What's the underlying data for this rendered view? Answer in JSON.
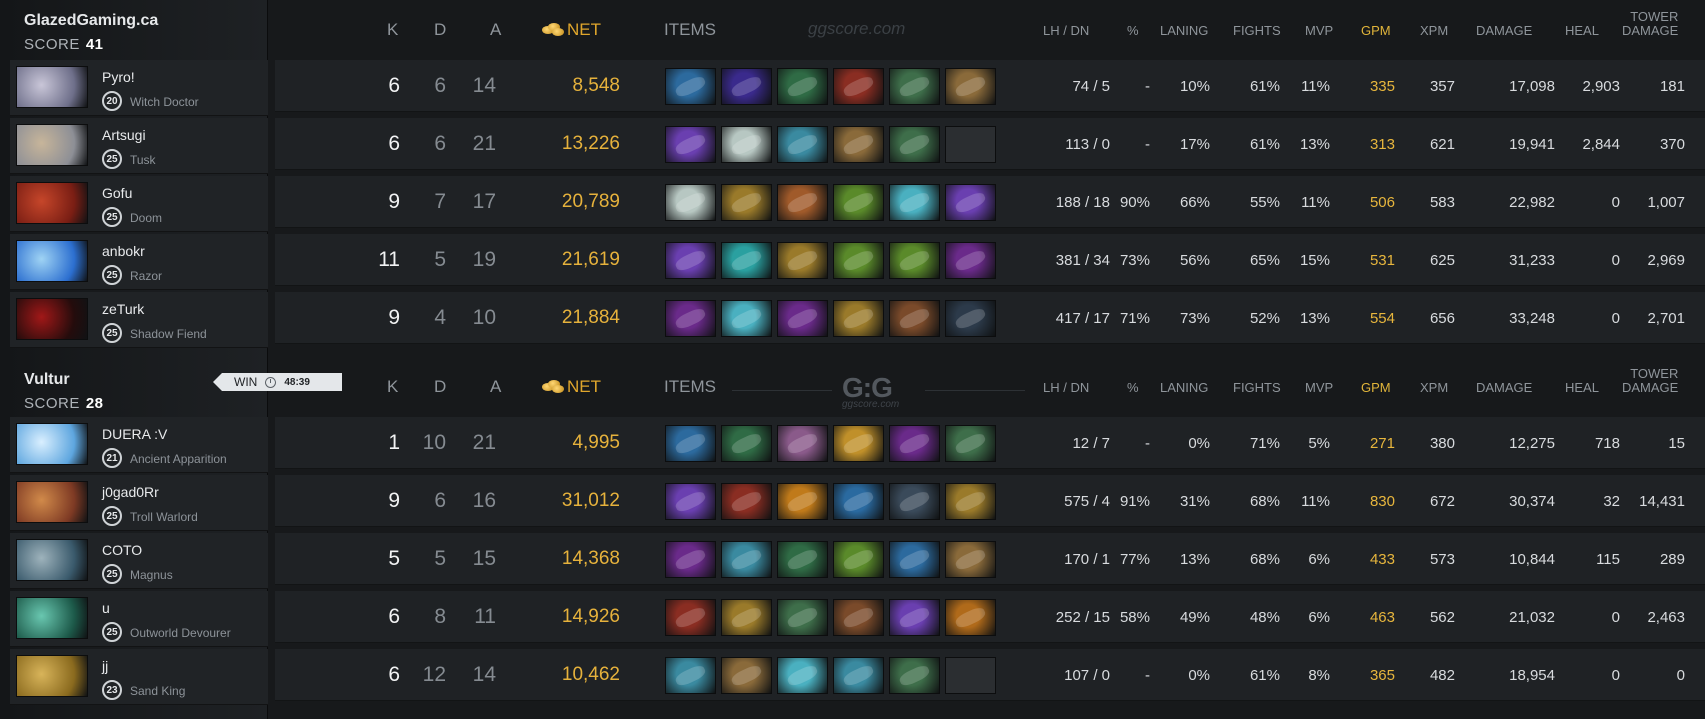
{
  "colors": {
    "item_palette": [
      "#2c6a9e",
      "#3a2a8c",
      "#2f6b45",
      "#8a2d22",
      "#3e6e4a",
      "#8a6a3a",
      "#6a3fb0",
      "#b7c7c2",
      "#3a8aa0",
      "#9a7a2a",
      "#a05a2a",
      "#5a8a2a",
      "#4ab0c0",
      "#2c3a4a",
      "#6a2a8a",
      "#b06a1a",
      "#2aa0a0",
      "#7a4a2a",
      "#c0902a",
      "#2a6aa0",
      "#3a4a5a",
      "#8a5a8a",
      "#c07a1a"
    ],
    "portrait": {
      "witch-doctor": [
        "#6e6f8a",
        "#c9c6d8"
      ],
      "tusk": [
        "#8d8f96",
        "#c7b59a"
      ],
      "doom": [
        "#7a1e14",
        "#c6462a"
      ],
      "razor": [
        "#2c6fd0",
        "#9fd3f4"
      ],
      "shadow-fiend": [
        "#240c0c",
        "#a11818"
      ],
      "ancient-apparition": [
        "#5ea6df",
        "#d9efff"
      ],
      "troll-warlord": [
        "#7e3a24",
        "#d18a4a"
      ],
      "magnus": [
        "#3a5a6c",
        "#9eb3bc"
      ],
      "outworld-devourer": [
        "#1d5a4a",
        "#69c7b0"
      ],
      "sand-king": [
        "#8a6a1e",
        "#d8b45a"
      ]
    }
  },
  "teams": [
    {
      "name": "GlazedGaming.ca",
      "score_label": "SCORE",
      "score": "41",
      "header": {
        "k": "K",
        "d": "D",
        "a": "A",
        "net": "NET",
        "items": "ITEMS",
        "lh_dn": "LH / DN",
        "pct": "%",
        "laning": "LANING",
        "fights": "FIGHTS",
        "mvp": "MVP",
        "gpm": "GPM",
        "xpm": "XPM",
        "damage": "DAMAGE",
        "heal": "HEAL",
        "tower_damage_l1": "TOWER",
        "tower_damage_l2": "DAMAGE"
      },
      "watermark": "ggscore.com",
      "players": [
        {
          "name": "Pyro!",
          "level": "20",
          "hero": "Witch Doctor",
          "portrait": "witch-doctor",
          "k": "6",
          "d": "6",
          "a": "14",
          "net": "8,548",
          "items": [
            0,
            1,
            2,
            3,
            4,
            5
          ],
          "lh_dn": "74  /  5",
          "pct": "-",
          "laning": "10%",
          "fights": "61%",
          "mvp": "11%",
          "gpm": "335",
          "xpm": "357",
          "damage": "17,098",
          "heal": "2,903",
          "tower": "181"
        },
        {
          "name": "Artsugi",
          "level": "25",
          "hero": "Tusk",
          "portrait": "tusk",
          "k": "6",
          "d": "6",
          "a": "21",
          "net": "13,226",
          "items": [
            6,
            7,
            8,
            5,
            4,
            -1
          ],
          "lh_dn": "113  /  0",
          "pct": "-",
          "laning": "17%",
          "fights": "61%",
          "mvp": "13%",
          "gpm": "313",
          "xpm": "621",
          "damage": "19,941",
          "heal": "2,844",
          "tower": "370"
        },
        {
          "name": "Gofu",
          "level": "25",
          "hero": "Doom",
          "portrait": "doom",
          "k": "9",
          "d": "7",
          "a": "17",
          "net": "20,789",
          "items": [
            7,
            9,
            10,
            11,
            12,
            6
          ],
          "lh_dn": "188  /  18",
          "pct": "90%",
          "laning": "66%",
          "fights": "55%",
          "mvp": "11%",
          "gpm": "506",
          "xpm": "583",
          "damage": "22,982",
          "heal": "0",
          "tower": "1,007"
        },
        {
          "name": "anbokr",
          "level": "25",
          "hero": "Razor",
          "portrait": "razor",
          "k": "11",
          "d": "5",
          "a": "19",
          "net": "21,619",
          "items": [
            6,
            16,
            9,
            11,
            11,
            14
          ],
          "lh_dn": "381  /  34",
          "pct": "73%",
          "laning": "56%",
          "fights": "65%",
          "mvp": "15%",
          "gpm": "531",
          "xpm": "625",
          "damage": "31,233",
          "heal": "0",
          "tower": "2,969"
        },
        {
          "name": "zeTurk",
          "level": "25",
          "hero": "Shadow Fiend",
          "portrait": "shadow-fiend",
          "k": "9",
          "d": "4",
          "a": "10",
          "net": "21,884",
          "items": [
            14,
            12,
            14,
            9,
            17,
            13
          ],
          "lh_dn": "417  /  17",
          "pct": "71%",
          "laning": "73%",
          "fights": "52%",
          "mvp": "13%",
          "gpm": "554",
          "xpm": "656",
          "damage": "33,248",
          "heal": "0",
          "tower": "2,701"
        }
      ]
    },
    {
      "name": "Vultur",
      "score_label": "SCORE",
      "score": "28",
      "result": "WIN",
      "duration": "48:39",
      "header": {
        "k": "K",
        "d": "D",
        "a": "A",
        "net": "NET",
        "items": "ITEMS",
        "lh_dn": "LH / DN",
        "pct": "%",
        "laning": "LANING",
        "fights": "FIGHTS",
        "mvp": "MVP",
        "gpm": "GPM",
        "xpm": "XPM",
        "damage": "DAMAGE",
        "heal": "HEAL",
        "tower_damage_l1": "TOWER",
        "tower_damage_l2": "DAMAGE"
      },
      "logo": "G:G",
      "logo_sub": "ggscore.com",
      "players": [
        {
          "name": "DUERA :V",
          "level": "21",
          "hero": "Ancient Apparition",
          "portrait": "ancient-apparition",
          "k": "1",
          "d": "10",
          "a": "21",
          "net": "4,995",
          "items": [
            0,
            2,
            21,
            18,
            14,
            4
          ],
          "lh_dn": "12  /  7",
          "pct": "-",
          "laning": "0%",
          "fights": "71%",
          "mvp": "5%",
          "gpm": "271",
          "xpm": "380",
          "damage": "12,275",
          "heal": "718",
          "tower": "15"
        },
        {
          "name": "j0gad0Rr",
          "level": "25",
          "hero": "Troll Warlord",
          "portrait": "troll-warlord",
          "k": "9",
          "d": "6",
          "a": "16",
          "net": "31,012",
          "items": [
            6,
            3,
            22,
            19,
            20,
            9
          ],
          "lh_dn": "575  /  4",
          "pct": "91%",
          "laning": "31%",
          "fights": "68%",
          "mvp": "11%",
          "gpm": "830",
          "xpm": "672",
          "damage": "30,374",
          "heal": "32",
          "tower": "14,431"
        },
        {
          "name": "COTO",
          "level": "25",
          "hero": "Magnus",
          "portrait": "magnus",
          "k": "5",
          "d": "5",
          "a": "15",
          "net": "14,368",
          "items": [
            14,
            8,
            2,
            11,
            0,
            5
          ],
          "lh_dn": "170  /  1",
          "pct": "77%",
          "laning": "13%",
          "fights": "68%",
          "mvp": "6%",
          "gpm": "433",
          "xpm": "573",
          "damage": "10,844",
          "heal": "115",
          "tower": "289"
        },
        {
          "name": "u",
          "level": "25",
          "hero": "Outworld Devourer",
          "portrait": "outworld-devourer",
          "k": "6",
          "d": "8",
          "a": "11",
          "net": "14,926",
          "items": [
            3,
            9,
            4,
            17,
            6,
            15
          ],
          "lh_dn": "252  /  15",
          "pct": "58%",
          "laning": "49%",
          "fights": "48%",
          "mvp": "6%",
          "gpm": "463",
          "xpm": "562",
          "damage": "21,032",
          "heal": "0",
          "tower": "2,463"
        },
        {
          "name": "jj",
          "level": "23",
          "hero": "Sand King",
          "portrait": "sand-king",
          "k": "6",
          "d": "12",
          "a": "14",
          "net": "10,462",
          "items": [
            8,
            5,
            12,
            8,
            4,
            -1
          ],
          "lh_dn": "107  /  0",
          "pct": "-",
          "laning": "0%",
          "fights": "61%",
          "mvp": "8%",
          "gpm": "365",
          "xpm": "482",
          "damage": "18,954",
          "heal": "0",
          "tower": "0"
        }
      ]
    }
  ]
}
